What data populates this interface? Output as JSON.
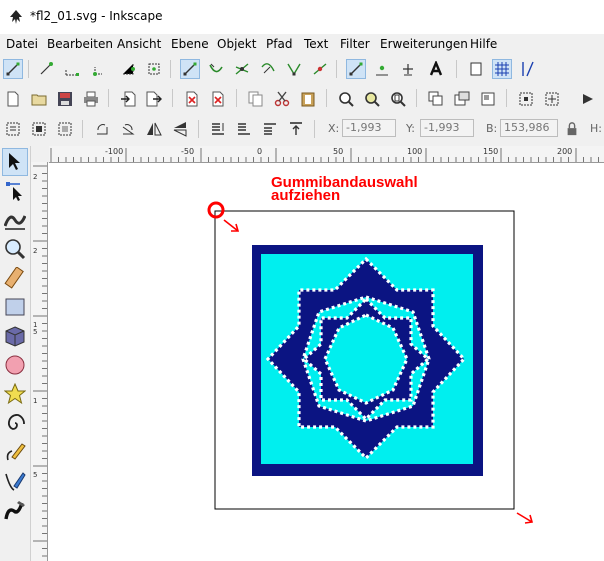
{
  "window": {
    "title": "*fl2_01.svg - Inkscape",
    "icon": "inkscape-icon"
  },
  "menu": [
    "Datei",
    "Bearbeiten",
    "Ansicht",
    "Ebene",
    "Objekt",
    "Pfad",
    "Text",
    "Filter",
    "Erweiterungen",
    "Hilfe"
  ],
  "toolbar_controls": {
    "x_label": "X:",
    "x_value": "-1,993",
    "y_label": "Y:",
    "y_value": "-1,993",
    "b_label": "B:",
    "b_value": "153,986",
    "h_label": "H:"
  },
  "ruler": {
    "h_ticks": [
      "-100",
      "-50",
      "0",
      "50",
      "100",
      "150",
      "200"
    ],
    "v_ticks": [
      "2",
      "2",
      "1 5",
      "1",
      "5"
    ]
  },
  "annotation": {
    "line1": "Gummibandauswahl",
    "line2": "aufziehen",
    "color": "#ff0000"
  },
  "colors": {
    "navy": "#0b1482",
    "cyan": "#00efef",
    "accent": "#cfe3f6"
  },
  "tools": [
    "selector-icon",
    "node-icon",
    "tweak-icon",
    "zoom-icon",
    "measure-icon",
    "rect-icon",
    "box3d-icon",
    "ellipse-icon",
    "star-icon",
    "spiral-icon",
    "pencil-icon",
    "pen-icon",
    "calligraphy-icon"
  ]
}
